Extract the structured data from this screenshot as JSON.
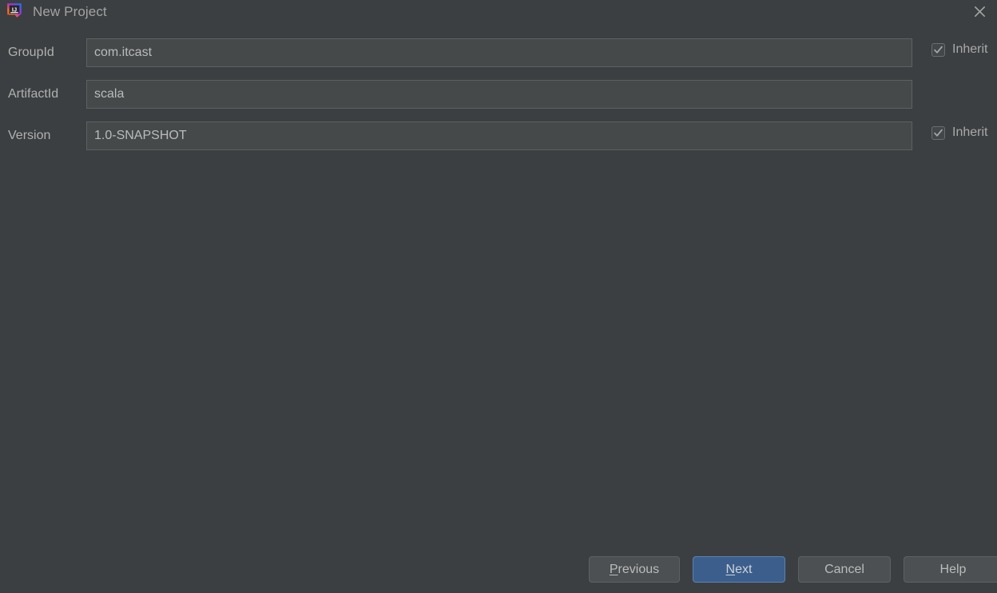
{
  "window": {
    "title": "New Project",
    "app_icon": "intellij-idea-icon",
    "close_icon": "close-icon",
    "background_color": "#3c3f41"
  },
  "form": {
    "fields": [
      {
        "label": "GroupId",
        "value": "com.itcast",
        "placeholder": "",
        "name": "groupid",
        "inherit": {
          "label": "Inherit",
          "checked": true
        }
      },
      {
        "label": "ArtifactId",
        "value": "scala",
        "placeholder": "",
        "name": "artifactid",
        "inherit": null
      },
      {
        "label": "Version",
        "value": "1.0-SNAPSHOT",
        "placeholder": "",
        "name": "version",
        "inherit": {
          "label": "Inherit",
          "checked": true
        }
      }
    ]
  },
  "buttons": {
    "previous": {
      "mnemonic": "P",
      "rest": "revious"
    },
    "next": {
      "mnemonic": "N",
      "rest": "ext",
      "default": true,
      "accent_color": "#3c5e8c"
    },
    "cancel": {
      "label": "Cancel"
    },
    "help": {
      "label": "Help"
    }
  }
}
